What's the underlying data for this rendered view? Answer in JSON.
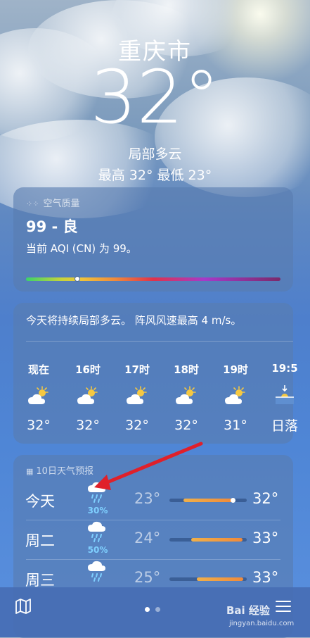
{
  "location": {
    "city": "重庆市",
    "temperature": "32°",
    "condition": "局部多云",
    "high_low": "最高 32°  最低 23°"
  },
  "air_quality": {
    "label": "空气质量",
    "value": "99 - 良",
    "description": "当前 AQI (CN) 为 99。",
    "level": 0.2
  },
  "hourly": {
    "summary": "今天将持续局部多云。 阵风风速最高 4 m/s。",
    "items": [
      {
        "time": "现在",
        "icon": "partly-cloudy-icon",
        "temp": "32°"
      },
      {
        "time": "16时",
        "icon": "partly-cloudy-icon",
        "temp": "32°"
      },
      {
        "time": "17时",
        "icon": "partly-cloudy-icon",
        "temp": "32°"
      },
      {
        "time": "18时",
        "icon": "partly-cloudy-icon",
        "temp": "32°"
      },
      {
        "time": "19时",
        "icon": "partly-cloudy-icon",
        "temp": "31°"
      },
      {
        "time": "19:5",
        "icon": "sunset-icon",
        "temp": "日落"
      }
    ]
  },
  "daily": {
    "label": "10日天气预报",
    "items": [
      {
        "day": "今天",
        "icon": "rain-icon",
        "precip": "30%",
        "low": "23°",
        "high": "32°",
        "range_start": 0.18,
        "range_end": 0.82,
        "current": 0.82
      },
      {
        "day": "周二",
        "icon": "rain-icon",
        "precip": "50%",
        "low": "24°",
        "high": "33°",
        "range_start": 0.28,
        "range_end": 0.95
      },
      {
        "day": "周三",
        "icon": "rain-icon",
        "precip": "",
        "low": "25°",
        "high": "33°",
        "range_start": 0.35,
        "range_end": 0.95
      }
    ]
  },
  "bottom_bar": {
    "page_count": 2,
    "current_page": 1
  },
  "watermark": {
    "brand": "Bai 经验",
    "url": "jingyan.baidu.com"
  },
  "colors": {
    "precip": "#7fd0ff",
    "arrow": "#e0202a",
    "range": "#f08a3a"
  }
}
